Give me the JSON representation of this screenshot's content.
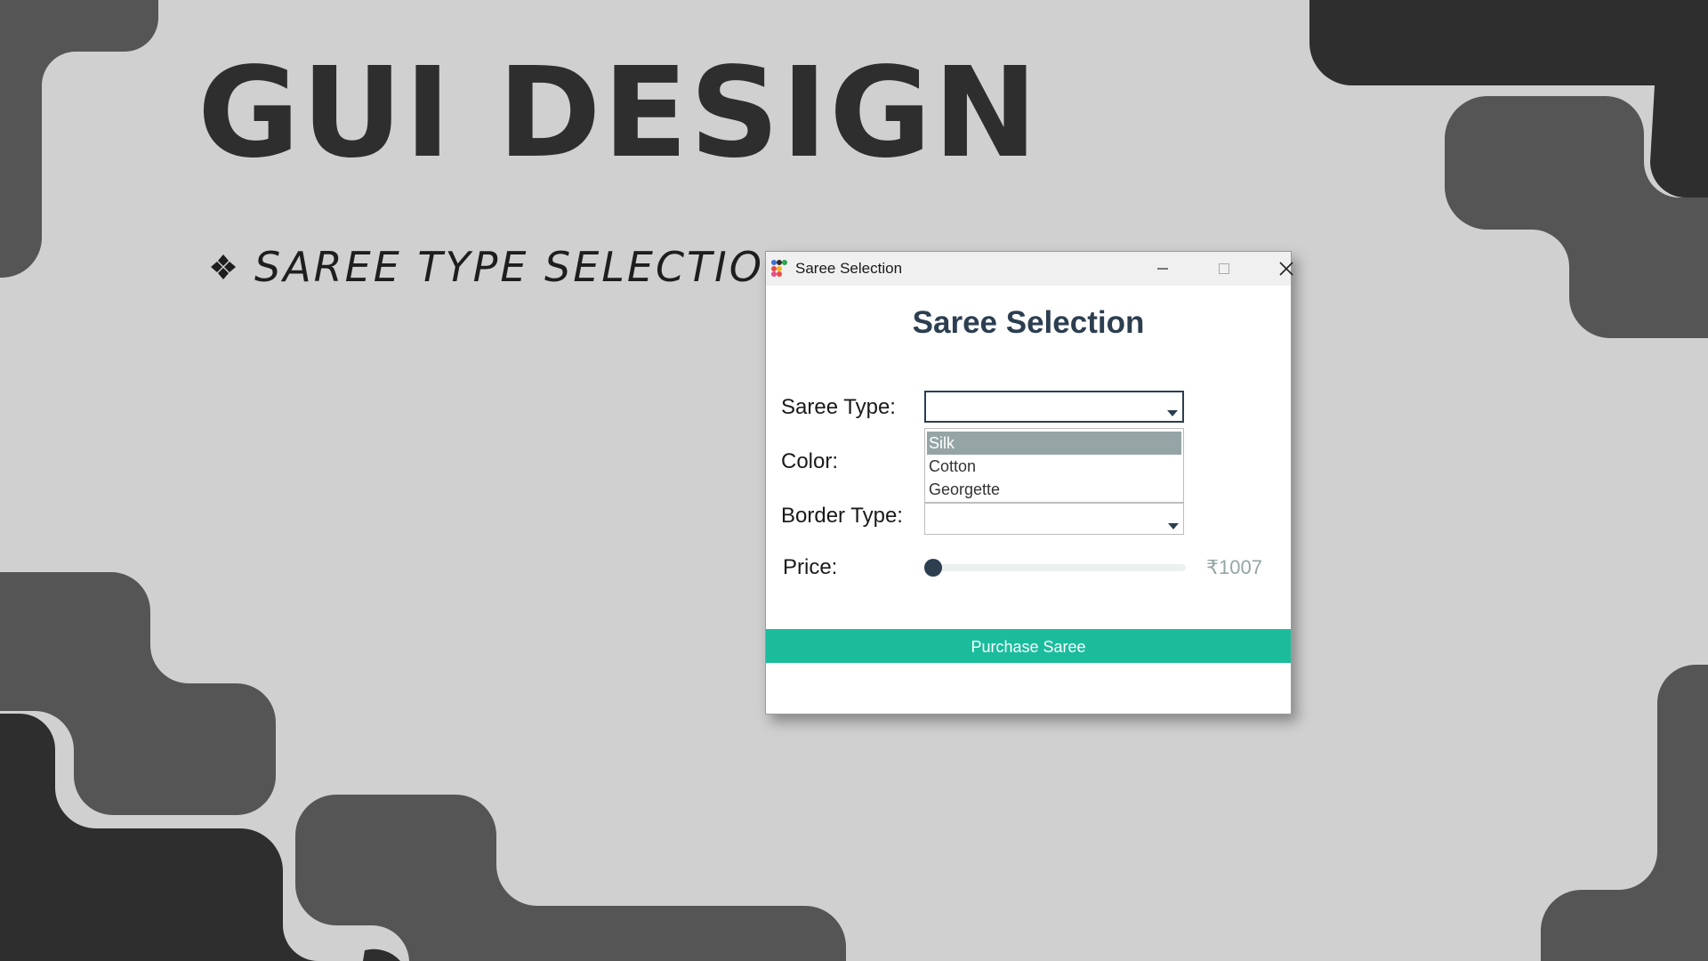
{
  "slide": {
    "title": "GUI DESIGN",
    "bullet_icon": "four-diamond-bullet-icon",
    "bullet_text": "SAREE TYPE SELECTION"
  },
  "window": {
    "title": "Saree Selection",
    "app_icon": "colored-dots-app-icon",
    "controls": [
      "minimize-icon",
      "maximize-icon",
      "close-icon"
    ],
    "heading": "Saree Selection",
    "form": {
      "saree_type_label": "Saree Type:",
      "saree_type_value": "",
      "saree_type_options": [
        "Silk",
        "Cotton",
        "Georgette"
      ],
      "saree_type_highlighted": "Silk",
      "color_label": "Color:",
      "border_type_label": "Border Type:",
      "border_type_value": "",
      "price_label": "Price:",
      "price_value": "₹1007",
      "price_slider_position": 0.0
    },
    "purchase_button": "Purchase Saree"
  },
  "colors": {
    "background": "#d0d0d0",
    "shape_dark": "#2e2e2e",
    "shape_mid": "#555555",
    "heading": "#2c3e50",
    "accent": "#1abc9c",
    "list_highlight": "#95a5a6"
  }
}
